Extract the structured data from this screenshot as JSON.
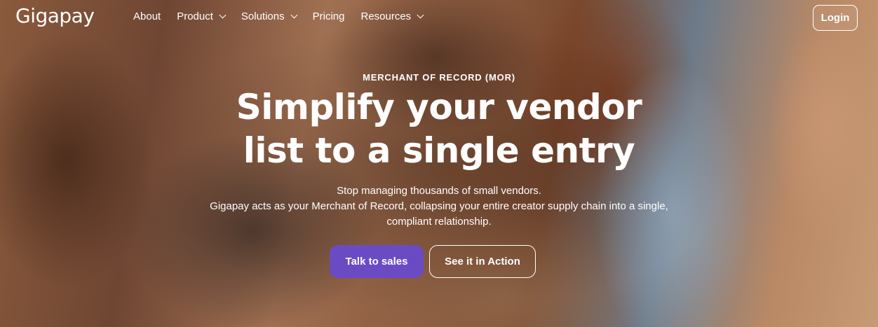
{
  "brand": {
    "logo_text": "Gigapay"
  },
  "nav": {
    "items": [
      {
        "label": "About",
        "has_dropdown": false
      },
      {
        "label": "Product",
        "has_dropdown": true
      },
      {
        "label": "Solutions",
        "has_dropdown": true
      },
      {
        "label": "Pricing",
        "has_dropdown": false
      },
      {
        "label": "Resources",
        "has_dropdown": true
      }
    ],
    "login_label": "Login"
  },
  "hero": {
    "eyebrow": "MERCHANT OF RECORD (MOR)",
    "headline_line1": "Simplify your vendor",
    "headline_line2": "list to a single entry",
    "sub_line1": "Stop managing thousands of small vendors.",
    "sub_line2": "Gigapay acts as your Merchant of Record, collapsing your entire creator supply chain into a single,",
    "sub_line3": "compliant relationship.",
    "primary_cta": "Talk to sales",
    "secondary_cta": "See it in Action"
  },
  "colors": {
    "primary_button": "#6b4bc4",
    "text": "#ffffff"
  }
}
